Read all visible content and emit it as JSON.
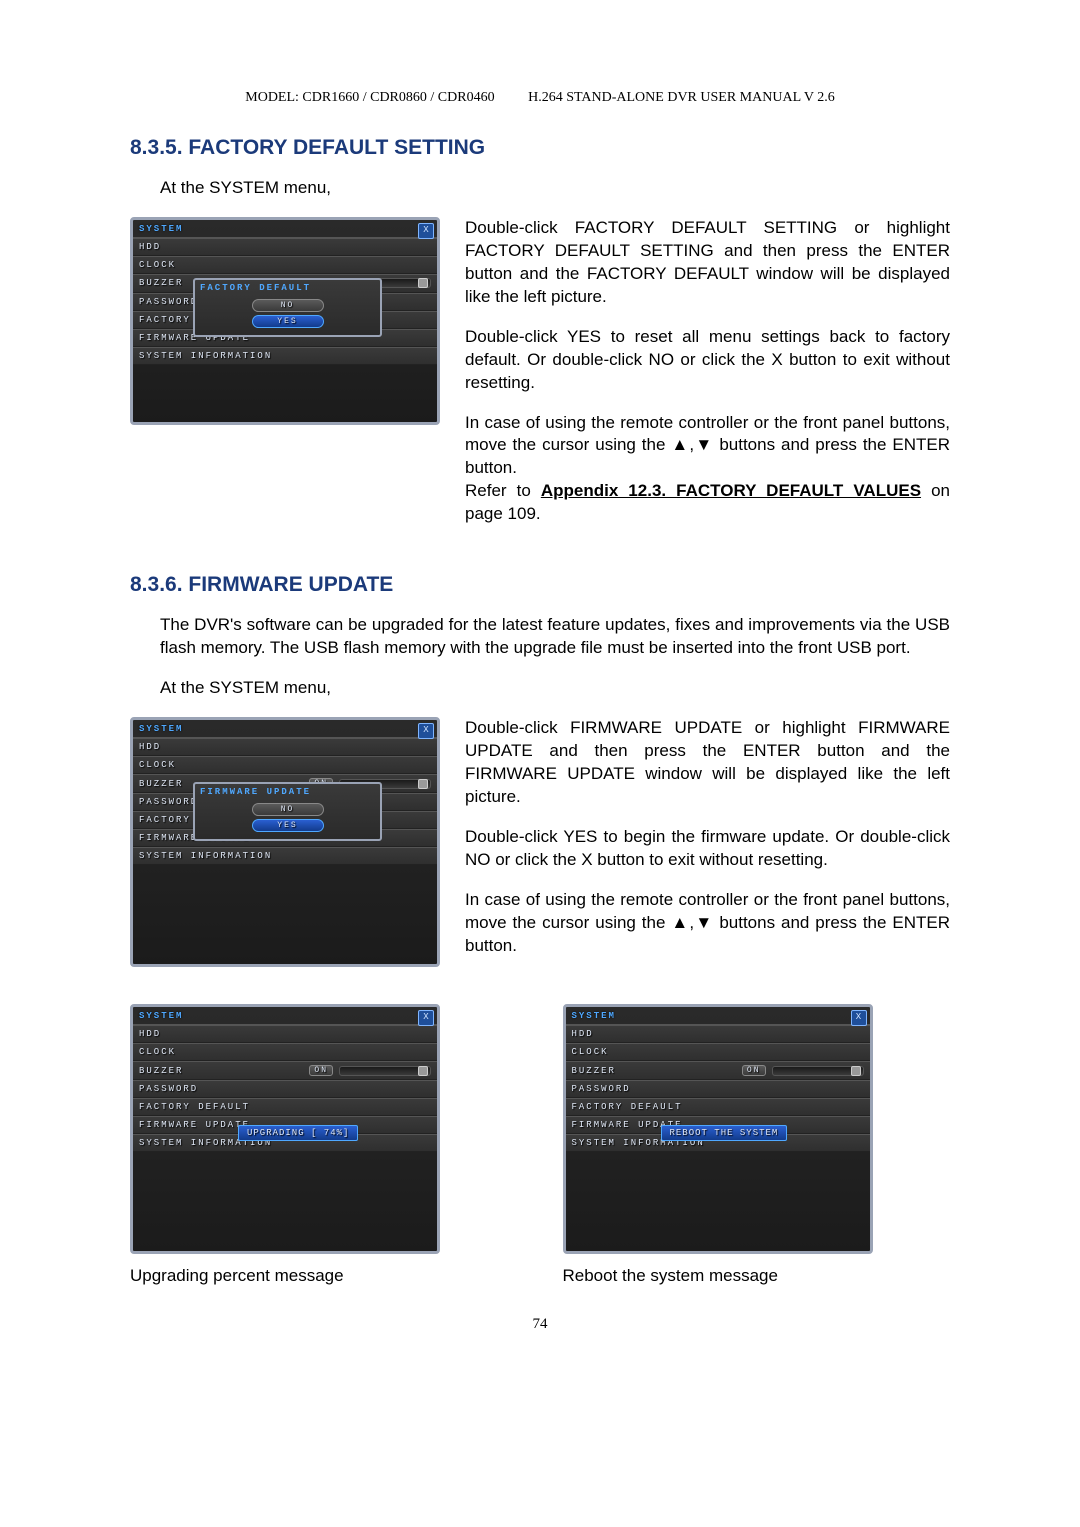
{
  "header": {
    "model": "MODEL: CDR1660 / CDR0860 / CDR0460",
    "manual": "H.264 STAND-ALONE DVR USER MANUAL V 2.6"
  },
  "s835": {
    "title": "8.3.5.  FACTORY DEFAULT SETTING",
    "lead": "At the SYSTEM menu,",
    "para1": "Double-click FACTORY DEFAULT SETTING or highlight FACTORY DEFAULT SETTING and then press the ENTER button and the FACTORY DEFAULT window will be displayed like the left picture.",
    "para2": "Double-click YES to reset all menu settings back to factory default. Or double-click NO or click the X button to exit without resetting.",
    "para3": "In case of using the remote controller or the front panel buttons, move the cursor using the ▲,▼ buttons and press the ENTER button.",
    "refer_prefix": "Refer to ",
    "refer_link": "Appendix 12.3. FACTORY DEFAULT VALUES",
    "refer_suffix": " on page 109."
  },
  "s836": {
    "title": "8.3.6.  FIRMWARE UPDATE",
    "intro": "The DVR's software can be upgraded for the latest feature updates, fixes and improvements via the USB flash memory.  The USB flash memory with the upgrade file must be inserted into the front USB port.",
    "lead": "At the SYSTEM menu,",
    "para1": "Double-click FIRMWARE UPDATE or highlight FIRMWARE UPDATE and then press the ENTER button and the FIRMWARE UPDATE window will be displayed like the left picture.",
    "para2": "Double-click YES to begin the firmware update. Or double-click NO or click the X button to exit without resetting.",
    "para3": "In case of using the remote controller or the front panel buttons, move the cursor using the ▲,▼ buttons and press the ENTER button."
  },
  "captions": {
    "upgrading": "Upgrading percent message",
    "reboot": "Reboot the system message"
  },
  "dvr": {
    "title": "SYSTEM",
    "close": "X",
    "rows": {
      "hdd": "HDD",
      "clock": "CLOCK",
      "buzzer": "BUZZER",
      "password": "PASSWORD",
      "factory": "FACTORY DEFAULT",
      "firmware": "FIRMWARE UPDATE",
      "sysinfo": "SYSTEM INFORMATION"
    },
    "on": "ON",
    "modal_factory": "FACTORY DEFAULT",
    "modal_firmware": "FIRMWARE UPDATE",
    "no": "NO",
    "yes": "YES",
    "upgrading": "UPGRADING [ 74%]",
    "reboot": "REBOOT THE SYSTEM"
  },
  "page_number": "74"
}
